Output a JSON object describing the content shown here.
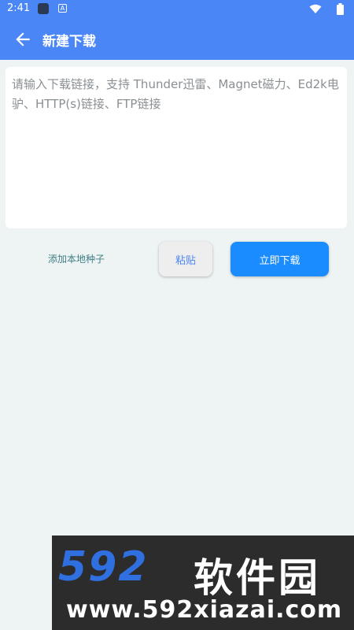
{
  "status_bar": {
    "time": "2:41",
    "icons": [
      "app-icon",
      "a-icon",
      "wifi-icon",
      "battery-icon"
    ]
  },
  "app_bar": {
    "back_icon": "arrow-left-icon",
    "title": "新建下载"
  },
  "link_input": {
    "value": "",
    "placeholder": "请输入下载链接，支持 Thunder迅雷、Magnet磁力、Ed2k电驴、HTTP(s)链接、FTP链接"
  },
  "actions": {
    "add_local_seed": "添加本地种子",
    "paste": "粘贴",
    "download_now": "立即下载"
  },
  "watermark": {
    "logo": "592",
    "logo_cn": "软件园",
    "url": "www.592xiazai.com"
  },
  "colors": {
    "primary": "#4a86f6",
    "download_button": "#1a8cff",
    "background": "#eef3f4",
    "seed_link": "#3f7f85"
  }
}
